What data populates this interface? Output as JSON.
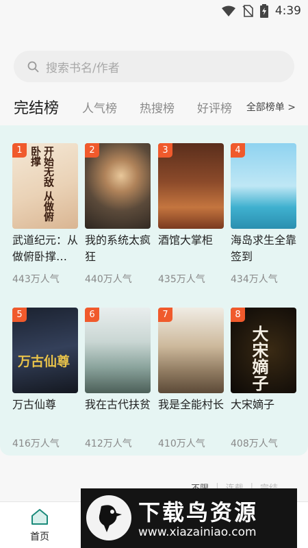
{
  "status": {
    "time": "4:39"
  },
  "search": {
    "placeholder": "搜索书名/作者"
  },
  "tabs": [
    {
      "label": "完结榜"
    },
    {
      "label": "人气榜"
    },
    {
      "label": "热搜榜"
    },
    {
      "label": "好评榜"
    },
    {
      "label": "全部榜单 >"
    }
  ],
  "books": [
    {
      "rank": "1",
      "title": "武道纪元：从做俯卧撑…",
      "popularity": "443万人气",
      "cover_text": "开始无敌 从做俯卧撑"
    },
    {
      "rank": "2",
      "title": "我的系统太疯狂",
      "popularity": "440万人气"
    },
    {
      "rank": "3",
      "title": "酒馆大掌柜",
      "popularity": "435万人气"
    },
    {
      "rank": "4",
      "title": "海岛求生全靠签到",
      "popularity": "434万人气"
    },
    {
      "rank": "5",
      "title": "万古仙尊",
      "popularity": "416万人气",
      "cover_text": "万古仙尊"
    },
    {
      "rank": "6",
      "title": "我在古代扶贫",
      "popularity": "412万人气"
    },
    {
      "rank": "7",
      "title": "我是全能村长",
      "popularity": "410万人气"
    },
    {
      "rank": "8",
      "title": "大宋嫡子",
      "popularity": "408万人气",
      "cover_text": "大宋嫡子"
    }
  ],
  "filter": {
    "items": [
      "不限",
      "连载",
      "完结"
    ]
  },
  "nav": {
    "home": "首页"
  },
  "banner": {
    "title": "下载鸟资源",
    "url": "www.xiazainiao.com"
  },
  "colors": {
    "accent": "#f05a2c",
    "panel_bg": "#e6f5f3"
  }
}
